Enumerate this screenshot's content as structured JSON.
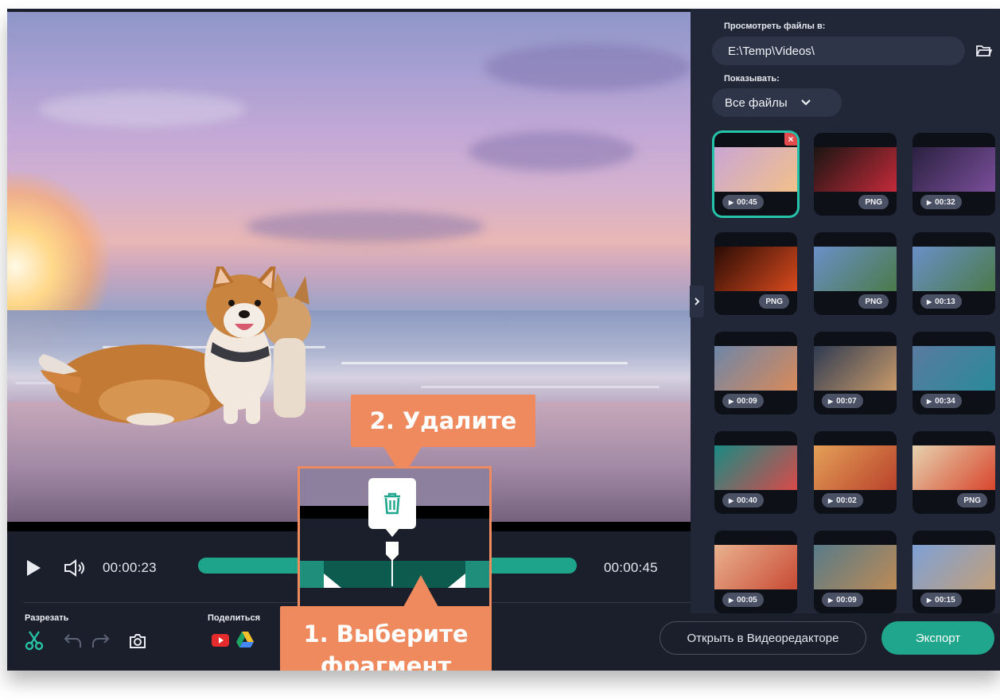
{
  "player": {
    "current_time": "00:00:23",
    "total_time": "00:00:45",
    "play_icon": "play-icon",
    "volume_icon": "volume-icon"
  },
  "toolbar": {
    "cut_label": "Разрезать",
    "share_label": "Поделиться",
    "open_editor_label": "Открыть в Видеоредакторе",
    "export_label": "Экспорт"
  },
  "panel": {
    "browse_label": "Просмотреть файлы в:",
    "path_value": "E:\\Temp\\Videos\\",
    "show_label": "Показывать:",
    "filter_value": "Все файлы"
  },
  "thumbnails": [
    {
      "label": "00:45",
      "kind": "duration",
      "selected": true
    },
    {
      "label": "PNG",
      "kind": "image"
    },
    {
      "label": "00:32",
      "kind": "duration"
    },
    {
      "label": "PNG",
      "kind": "image"
    },
    {
      "label": "PNG",
      "kind": "image"
    },
    {
      "label": "00:13",
      "kind": "duration"
    },
    {
      "label": "00:09",
      "kind": "duration"
    },
    {
      "label": "00:07",
      "kind": "duration"
    },
    {
      "label": "00:34",
      "kind": "duration"
    },
    {
      "label": "00:40",
      "kind": "duration"
    },
    {
      "label": "00:02",
      "kind": "duration"
    },
    {
      "label": "PNG",
      "kind": "image"
    },
    {
      "label": "00:05",
      "kind": "duration"
    },
    {
      "label": "00:09",
      "kind": "duration"
    },
    {
      "label": "00:15",
      "kind": "duration"
    }
  ],
  "tutorial": {
    "step_delete": "2. Удалите",
    "step_select_line1": "1. Выберите",
    "step_select_line2": "фрагмент"
  },
  "colors": {
    "accent": "#1fa68c",
    "callout": "#ef8a5e",
    "background": "#1b1f2b"
  }
}
